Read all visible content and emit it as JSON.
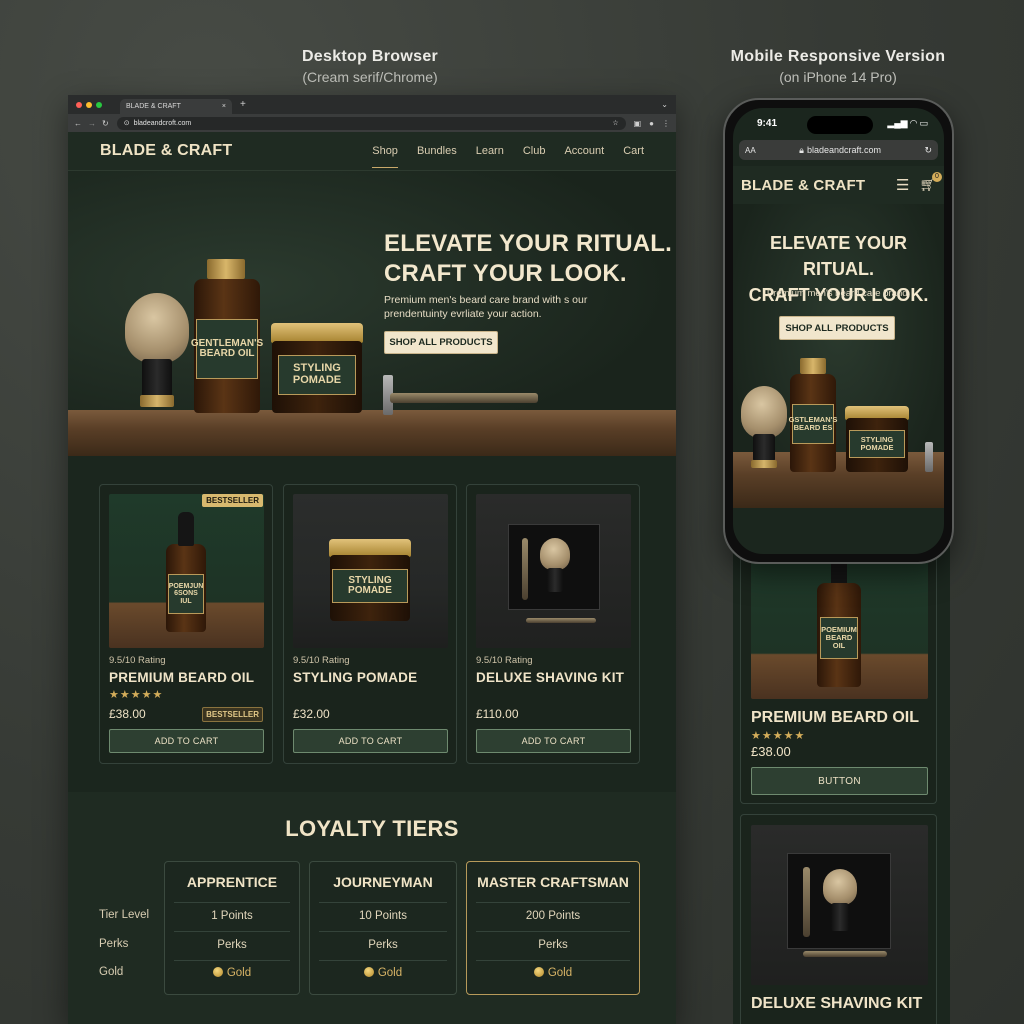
{
  "captions": {
    "desktop_title": "Desktop Browser",
    "desktop_sub": "(Cream serif/Chrome)",
    "mobile_title": "Mobile Responsive Version",
    "mobile_sub": "(on iPhone 14 Pro)"
  },
  "browser": {
    "tab_title": "BLADE & CRAFT",
    "tab_close": "×",
    "tab_plus": "+",
    "tab_chevron": "⌄",
    "url": "bladeandcroft.com",
    "back": "←",
    "forward": "→",
    "reload": "↻"
  },
  "site": {
    "brand": "BLADE & CRAFT",
    "nav": [
      "Shop",
      "Bundles",
      "Learn",
      "Club",
      "Account",
      "Cart"
    ],
    "hero": {
      "title_line1": "ELEVATE YOUR RITUAL.",
      "title_line2": "CRAFT YOUR LOOK.",
      "subtitle": "Premium men's beard care brand with s our prendentuinty evrliate your action.",
      "cta": "SHOP ALL PRODUCTS",
      "props": {
        "beard_oil_label": "GENTLEMAN'S BEARD OIL",
        "pomade_label": "STYLING POMADE"
      }
    },
    "products": [
      {
        "rating": "9.5/10 Rating",
        "name": "PREMIUM BEARD OIL",
        "stars": "★★★★★",
        "price": "£38.00",
        "badge": "BESTSELLER",
        "badge_top": "BESTSELLER",
        "button": "ADD TO CART",
        "img_label": "POEMJUN 6SONS IUL"
      },
      {
        "rating": "9.5/10 Rating",
        "name": "STYLING POMADE",
        "price": "£32.00",
        "button": "ADD TO CART",
        "img_label": "STYLING POMADE"
      },
      {
        "rating": "9.5/10 Rating",
        "name": "DELUXE SHAVING KIT",
        "price": "£110.00",
        "button": "ADD TO CART"
      }
    ],
    "loyalty": {
      "title": "LOYALTY TIERS",
      "row_labels": [
        "Tier Level",
        "Perks",
        "Gold"
      ],
      "tiers": [
        {
          "name": "APPRENTICE",
          "points": "1 Points",
          "perks": "Perks",
          "gold": "Gold"
        },
        {
          "name": "JOURNEYMAN",
          "points": "10 Points",
          "perks": "Perks",
          "gold": "Gold"
        },
        {
          "name": "MASTER CRAFTSMAN",
          "points": "200 Points",
          "perks": "Perks",
          "gold": "Gold"
        }
      ]
    }
  },
  "mobile": {
    "time": "9:41",
    "url_aa": "AA",
    "url": "bladeandcraft.com",
    "brand": "BLADE & CRAFT",
    "cart_count": "0",
    "hero_line1": "ELEVATE YOUR RITUAL.",
    "hero_line2": "CRAFT YOUR LOOK.",
    "hero_sub": "Premium men's beard care brand.",
    "cta": "SHOP ALL PRODUCTS",
    "hero_props": {
      "oil_label": "GSTLEMAN'S BEARD ES",
      "pomade_label": "STYLING POMADE"
    },
    "card1": {
      "name": "PREMIUM BEARD OIL",
      "stars": "★★★★★",
      "price": "£38.00",
      "button": "BUTTON",
      "img_label": "POEMIUM BEARD OIL"
    },
    "card2": {
      "name": "DELUXE SHAVING KIT"
    }
  }
}
